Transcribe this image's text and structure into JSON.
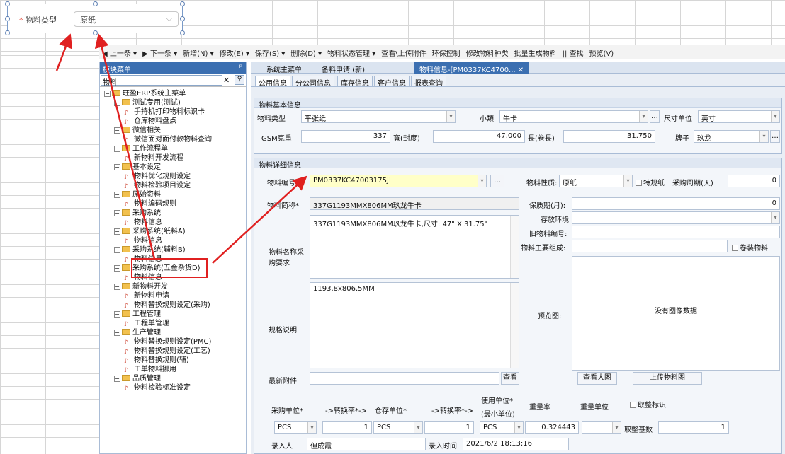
{
  "overlay": {
    "required_mark": "*",
    "label": "物料类型",
    "value": "原纸"
  },
  "toolbar": [
    "◀ 上一条 ▾",
    "▶ 下一条 ▾",
    "新增(N) ▾",
    "修改(E) ▾",
    "保存(S) ▾",
    "删除(D) ▾",
    "物料状态管理 ▾",
    "查看\\上传附件",
    "环保控制",
    "修改物料种类",
    "批量生成物料",
    "|| 查找",
    "预览(V)"
  ],
  "left_panel": {
    "title": "模块菜单",
    "pin": "ᵖ",
    "search": "物料",
    "clear": "✕",
    "icon": "⚲"
  },
  "tree": [
    {
      "text": "旺盈ERP系统主菜单",
      "lvl": 0,
      "k": "root"
    },
    {
      "text": "测试专用(测试)",
      "lvl": 1,
      "k": "f"
    },
    {
      "text": "手持机打印物料标识卡",
      "lvl": 2,
      "k": "l"
    },
    {
      "text": "仓库物料盘点",
      "lvl": 2,
      "k": "l"
    },
    {
      "text": "微信相关",
      "lvl": 1,
      "k": "f"
    },
    {
      "text": "微信面对面付款物料查询",
      "lvl": 2,
      "k": "l"
    },
    {
      "text": "工作流程单",
      "lvl": 1,
      "k": "f"
    },
    {
      "text": "新物料开发流程",
      "lvl": 2,
      "k": "l"
    },
    {
      "text": "基本设定",
      "lvl": 1,
      "k": "f"
    },
    {
      "text": "物料优化规则设定",
      "lvl": 2,
      "k": "l"
    },
    {
      "text": "物料检验项目设定",
      "lvl": 2,
      "k": "l"
    },
    {
      "text": "原始资料",
      "lvl": 1,
      "k": "f"
    },
    {
      "text": "物料编码规则",
      "lvl": 2,
      "k": "l"
    },
    {
      "text": "采购系统",
      "lvl": 1,
      "k": "f"
    },
    {
      "text": "物料信息",
      "lvl": 2,
      "k": "l"
    },
    {
      "text": "采购系统(纸料A)",
      "lvl": 1,
      "k": "f"
    },
    {
      "text": "物料信息",
      "lvl": 2,
      "k": "l"
    },
    {
      "text": "采购系统(辅料B)",
      "lvl": 1,
      "k": "f"
    },
    {
      "text": "物料信息",
      "lvl": 2,
      "k": "l"
    },
    {
      "text": "采购系统(五金杂货D)",
      "lvl": 1,
      "k": "f"
    },
    {
      "text": "物料信息",
      "lvl": 2,
      "k": "l"
    },
    {
      "text": "新物料开发",
      "lvl": 1,
      "k": "f"
    },
    {
      "text": "新物料申请",
      "lvl": 2,
      "k": "l"
    },
    {
      "text": "物料替换规则设定(采购)",
      "lvl": 2,
      "k": "l"
    },
    {
      "text": "工程管理",
      "lvl": 1,
      "k": "f"
    },
    {
      "text": "工程单管理",
      "lvl": 2,
      "k": "l"
    },
    {
      "text": "生产管理",
      "lvl": 1,
      "k": "f"
    },
    {
      "text": "物料替换规则设定(PMC)",
      "lvl": 2,
      "k": "l"
    },
    {
      "text": "物料替换规则设定(工艺)",
      "lvl": 2,
      "k": "l"
    },
    {
      "text": "物料替换规则(辅)",
      "lvl": 2,
      "k": "l"
    },
    {
      "text": "工单物料挪用",
      "lvl": 2,
      "k": "l"
    },
    {
      "text": "品质管理",
      "lvl": 1,
      "k": "f"
    },
    {
      "text": "物料检验标准设定",
      "lvl": 2,
      "k": "l"
    }
  ],
  "tabs": [
    "系统主菜单",
    "备料申请 (新)",
    "物料信息-[PM0337KC4700... ✕"
  ],
  "subtabs": [
    "公用信息",
    "分公司信息",
    "库存信息",
    "客户信息",
    "报表查询"
  ],
  "basic": {
    "title": "物料基本信息",
    "type_label": "物料类型",
    "type_value": "平张纸",
    "subclass_label": "小類",
    "subclass_value": "牛卡",
    "unit_label": "尺寸单位",
    "unit_value": "英寸",
    "gsm_label": "GSM克重",
    "gsm_value": "337",
    "width_label": "寬(封度)",
    "width_value": "47.000",
    "length_label": "長(卷長)",
    "length_value": "31.750",
    "brand_label": "牌子",
    "brand_value": "玖龙"
  },
  "detail": {
    "title": "物料详细信息",
    "code_label": "物料编号*",
    "code_value": "PM0337KC47003175JL",
    "short_label": "物料简称*",
    "short_value": "337G1193MMX806MM玖龙牛卡",
    "name_label": "物料名称采购要求",
    "name_value": "337G1193MMX806MM玖龙牛卡,尺寸: 47\" X 31.75\"",
    "spec_label": "规格说明",
    "spec_value": "1193.8x806.5MM",
    "attach_label": "最新附件",
    "view_btn": "查看",
    "nature_label": "物料性质:",
    "nature_value": "原纸",
    "special_label": "特规纸",
    "cycle_label": "采购周期(天)",
    "cycle_value": "0",
    "shelf_label": "保质期(月):",
    "shelf_value": "0",
    "env_label": "存放环境",
    "old_label": "旧物料编号:",
    "comp_label": "物料主要组成:",
    "roll_label": "卷装物料",
    "preview_label": "预览图:",
    "no_image": "没有图像数据",
    "view_big": "查看大图",
    "upload": "上传物料图"
  },
  "units": {
    "purchase_label": "采购单位*",
    "conv1_label": "->转换率*->",
    "stock_label": "仓存单位*",
    "conv2_label": "->转换率*->",
    "use_label": "使用单位*",
    "use_sub": "(最小单位)",
    "weight_label": "重量率",
    "wunit_label": "重量单位",
    "round_label": "取整标识",
    "purchase_value": "PCS",
    "conv1_value": "1",
    "stock_value": "PCS",
    "conv2_value": "1",
    "use_value": "PCS",
    "weight_value": "0.324443",
    "base_label": "取整基数",
    "base_value": "1"
  },
  "record": {
    "by_label": "录入人",
    "by_value": "但成霞",
    "time_label": "录入时间",
    "time_value": "2021/6/2 18:13:16"
  }
}
